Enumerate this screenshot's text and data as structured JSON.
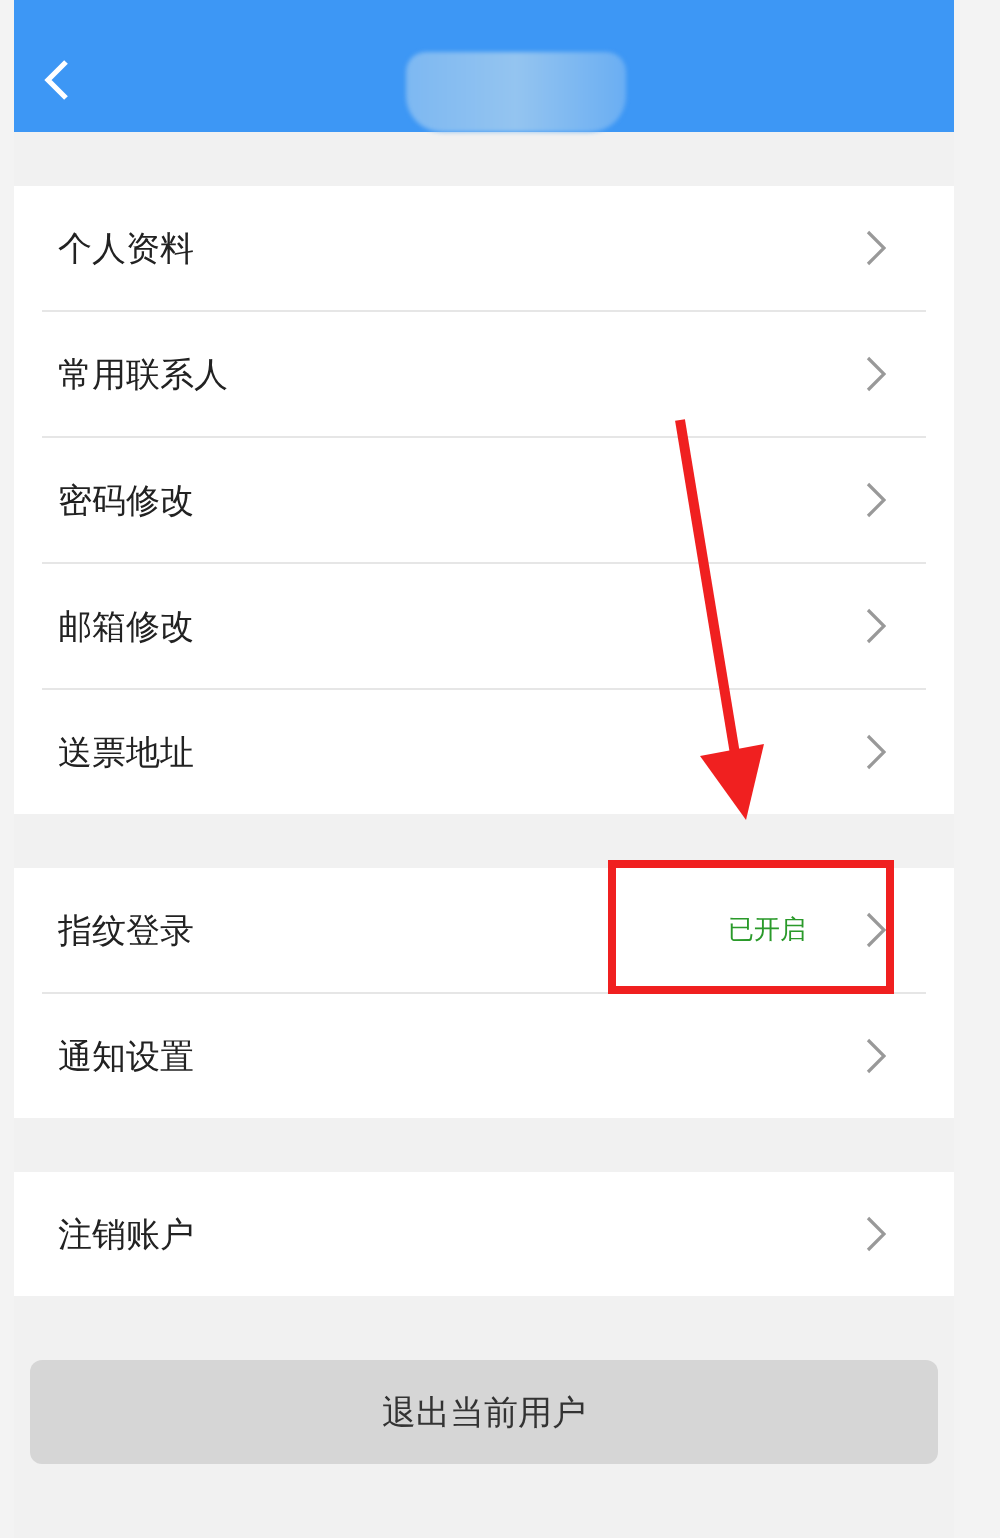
{
  "header": {
    "back_icon": true
  },
  "groups": [
    {
      "items": [
        {
          "label": "个人资料"
        },
        {
          "label": "常用联系人"
        },
        {
          "label": "密码修改"
        },
        {
          "label": "邮箱修改"
        },
        {
          "label": "送票地址"
        }
      ]
    },
    {
      "items": [
        {
          "label": "指纹登录",
          "value": "已开启"
        },
        {
          "label": "通知设置"
        }
      ]
    },
    {
      "items": [
        {
          "label": "注销账户"
        }
      ]
    }
  ],
  "logout_button": {
    "label": "退出当前用户"
  }
}
